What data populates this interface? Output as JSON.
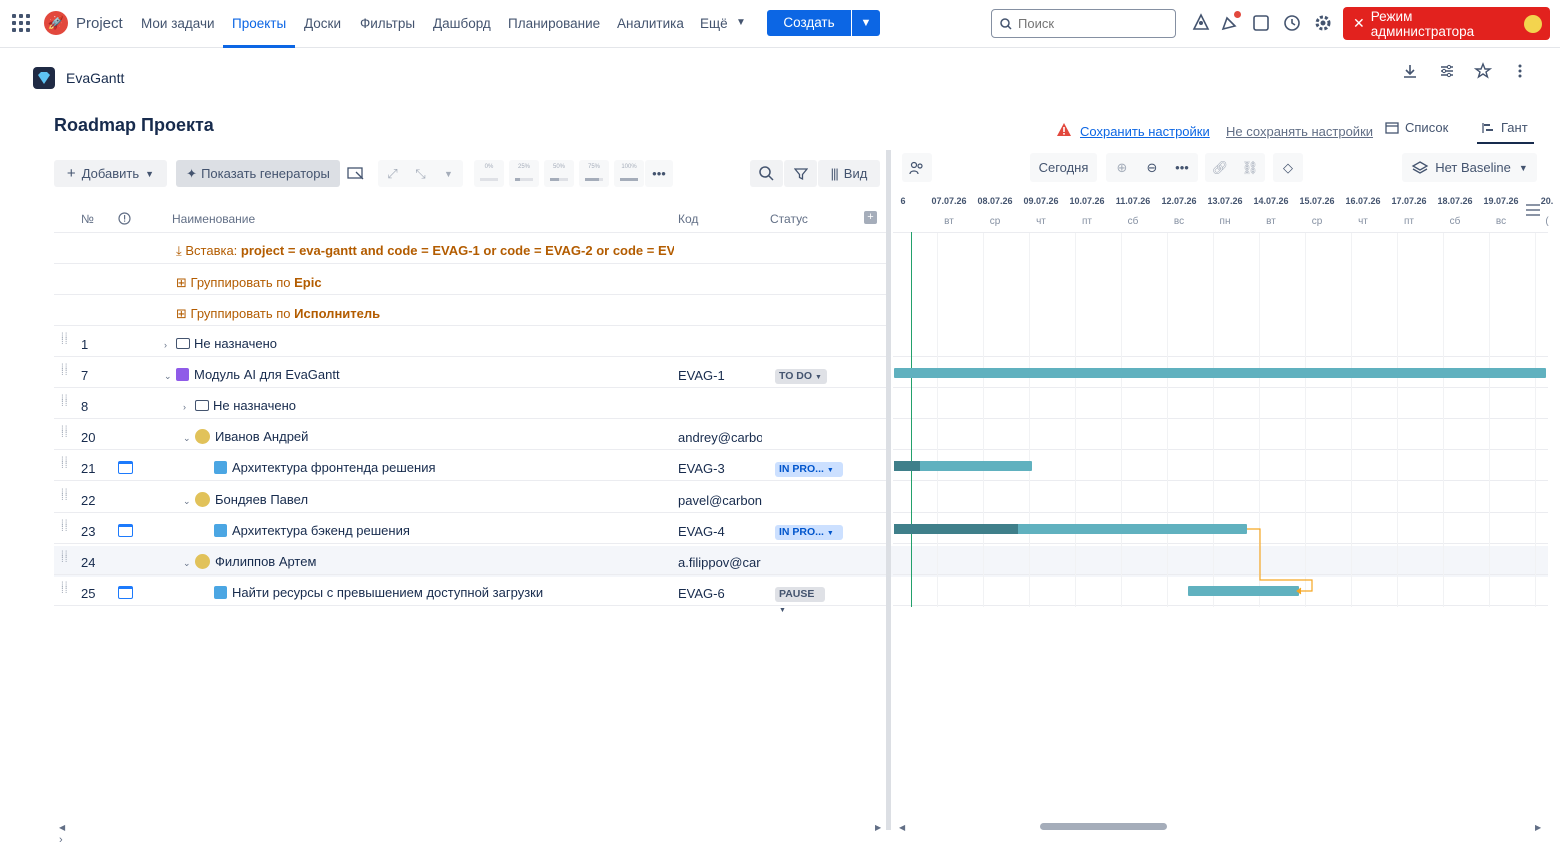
{
  "topnav": {
    "product": "Project",
    "items": [
      "Мои задачи",
      "Проекты",
      "Доски",
      "Фильтры",
      "Дашборд",
      "Планирование",
      "Аналитика",
      "Ещё"
    ],
    "active_index": 1,
    "create_label": "Создать",
    "search_placeholder": "Поиск",
    "admin_label": "Режим администратора"
  },
  "project": {
    "name": "EvaGantt",
    "title": "Roadmap Проекта",
    "save_label": "Сохранить настройки",
    "nosave_label": "Не сохранять настройки",
    "view_list": "Список",
    "view_gantt": "Гант"
  },
  "toolbar": {
    "add_label": "Добавить",
    "generators_label": "Показать генераторы",
    "percent_labels": [
      "0%",
      "25%",
      "50%",
      "75%",
      "100%"
    ],
    "percent_values": [
      0,
      0.25,
      0.5,
      0.75,
      1.0
    ],
    "view_label": "Вид"
  },
  "table": {
    "headers": {
      "num": "№",
      "name": "Наименование",
      "code": "Код",
      "status": "Статус"
    },
    "generators": {
      "insert_prefix": "Вставка: ",
      "insert_query": "project = eva-gantt and code = EVAG-1 or code = EVAG-2 or code = EV",
      "group1_prefix": "Группировать по ",
      "group1_field": "Epic",
      "group2_prefix": "Группировать по ",
      "group2_field": "Исполнитель"
    },
    "rows": [
      {
        "num": "1",
        "name": "Не назначено",
        "code": "",
        "status": ""
      },
      {
        "num": "7",
        "name": "Модуль AI для EvaGantt",
        "code": "EVAG-1",
        "status": "TO DO"
      },
      {
        "num": "8",
        "name": "Не назначено",
        "code": "",
        "status": ""
      },
      {
        "num": "20",
        "name": "Иванов Андрей",
        "code": "andrey@carbo",
        "status": ""
      },
      {
        "num": "21",
        "name": "Архитектура фронтенда решения",
        "code": "EVAG-3",
        "status": "IN PRO..."
      },
      {
        "num": "22",
        "name": "Бондяев Павел",
        "code": "pavel@carbon",
        "status": ""
      },
      {
        "num": "23",
        "name": "Архитектура бэкенд решения",
        "code": "EVAG-4",
        "status": "IN PRO..."
      },
      {
        "num": "24",
        "name": "Филиппов Артем",
        "code": "a.filippov@car",
        "status": ""
      },
      {
        "num": "25",
        "name": "Найти ресурсы с превышением доступной загрузки",
        "code": "EVAG-6",
        "status": "PAUSE"
      }
    ]
  },
  "gantt": {
    "today_label": "Сегодня",
    "baseline_label": "Нет Baseline",
    "dates": [
      "6",
      "07.07.26",
      "08.07.26",
      "09.07.26",
      "10.07.26",
      "11.07.26",
      "12.07.26",
      "13.07.26",
      "14.07.26",
      "15.07.26",
      "16.07.26",
      "17.07.26",
      "18.07.26",
      "19.07.26",
      "20."
    ],
    "weekdays": [
      "",
      "вт",
      "ср",
      "чт",
      "пт",
      "сб",
      "вс",
      "пн",
      "вт",
      "ср",
      "чт",
      "пт",
      "сб",
      "вс",
      "("
    ]
  },
  "colors": {
    "accent": "#0c66e4",
    "bar": "#60b1bf",
    "bar_progress": "#3f7f8a",
    "admin": "#e2221e",
    "generator": "#b35c00"
  }
}
